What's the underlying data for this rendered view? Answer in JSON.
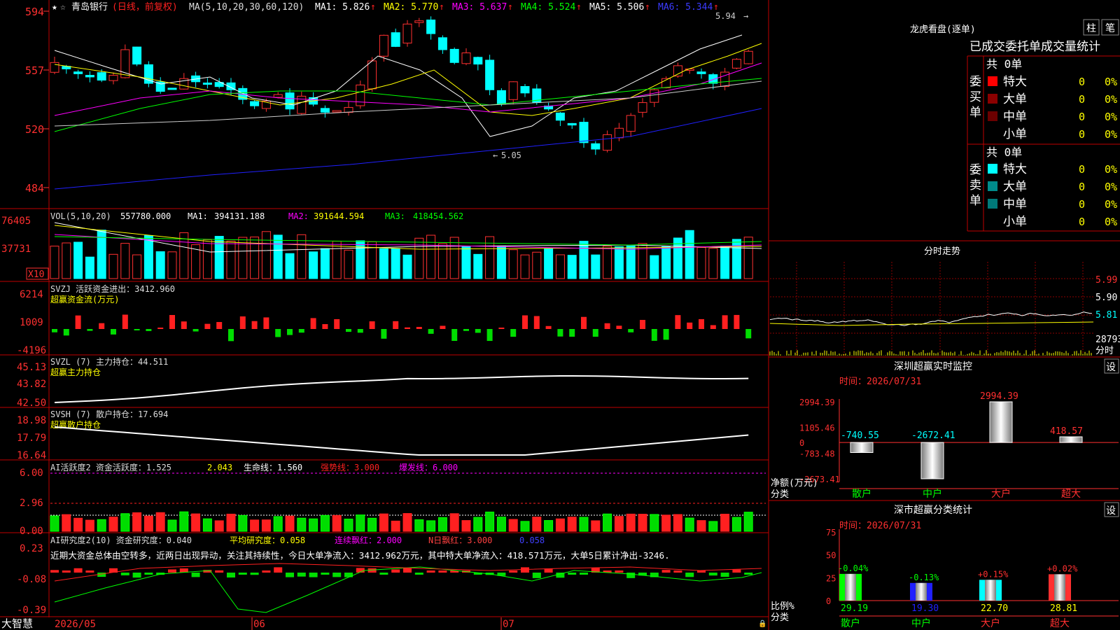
{
  "app": {
    "brand": "大智慧"
  },
  "kline": {
    "stock": "青岛银行",
    "period_tag": "(日线，前复权)",
    "ma_header": "MA(5,10,20,30,60,120)",
    "ma_values": [
      {
        "label": "MA1",
        "value": "5.826",
        "color": "#ffffff"
      },
      {
        "label": "MA2",
        "value": "5.770",
        "color": "#ffff00"
      },
      {
        "label": "MA3",
        "value": "5.637",
        "color": "#ff00ff"
      },
      {
        "label": "MA4",
        "value": "5.524",
        "color": "#00ff00"
      },
      {
        "label": "MA5",
        "value": "5.506",
        "color": "#ffffff"
      },
      {
        "label": "MA6",
        "value": "5.344",
        "color": "#3b3bff"
      }
    ],
    "yticks": [
      "594",
      "557",
      "520",
      "484"
    ],
    "high_label": "5.94",
    "low_label": "5.05",
    "dates": [
      "2026/05",
      "06",
      "07"
    ]
  },
  "vol": {
    "header": "VOL(5,10,20)",
    "value": "557780.000",
    "ma1": "394131.188",
    "ma2": "391644.594",
    "ma3": "418454.562",
    "yticks": [
      "76405",
      "37731"
    ],
    "unit": "X10"
  },
  "svzj": {
    "header": "SVZJ  活跃资金进出：3412.960",
    "sub": "超赢资金流(万元)",
    "yticks": [
      "6214",
      "1009",
      "-4196"
    ]
  },
  "svzl": {
    "header": "SVZL (7) 主力持仓：44.511",
    "sub": "超赢主力持仓",
    "yticks": [
      "45.13",
      "43.82",
      "42.50"
    ]
  },
  "svsh": {
    "header": "SVSH (7) 散户持仓：17.694",
    "sub": "超赢散户持仓",
    "yticks": [
      "18.98",
      "17.79",
      "16.64"
    ]
  },
  "ai1": {
    "header": "AI活跃度2 资金活跃度：1.525",
    "v2": "2.043",
    "life": "生命线：1.560",
    "strong": "强势线：3.000",
    "burst": "爆发线：6.000",
    "yticks": [
      "6.00",
      "2.96",
      "0.00"
    ]
  },
  "ai2": {
    "header": "AI研究度2(10) 资金研究度：0.040",
    "avg": "平均研究度：0.058",
    "streak": "连续飘红：2.000",
    "nday": "N日飘红：3.000",
    "last": "0.058",
    "comment": "近期大资金总体由空转多，近两日出现异动，关注其持续性，今日大单净流入：3412.962万元，其中特大单净流入：418.571万元，大单5日累计净出-3246.",
    "yticks": [
      "0.23",
      "-0.08",
      "-0.39"
    ]
  },
  "lhb": {
    "title": "龙虎看盘(逐单)",
    "btn1": "柱",
    "btn2": "笔",
    "subtitle": "已成交委托单成交量统计",
    "buy_label": "委买单",
    "sell_label": "委卖单",
    "buy_total": "共 0单",
    "sell_total": "共 0单",
    "buy_rows": [
      {
        "name": "特大",
        "count": "0",
        "pct": "0%",
        "color": "#ff0000"
      },
      {
        "name": "大单",
        "count": "0",
        "pct": "0%",
        "color": "#8b0000"
      },
      {
        "name": "中单",
        "count": "0",
        "pct": "0%",
        "color": "#6b0000"
      },
      {
        "name": "小单",
        "count": "0",
        "pct": "0%",
        "color": "#000000"
      }
    ],
    "sell_rows": [
      {
        "name": "特大",
        "count": "0",
        "pct": "0%",
        "color": "#00ffff"
      },
      {
        "name": "大单",
        "count": "0",
        "pct": "0%",
        "color": "#008b8b"
      },
      {
        "name": "中单",
        "count": "0",
        "pct": "0%",
        "color": "#007a7a"
      },
      {
        "name": "小单",
        "count": "0",
        "pct": "0%",
        "color": "#000000"
      }
    ]
  },
  "fenshi": {
    "title": "分时走势",
    "yticks": [
      "5.99",
      "5.90",
      "5.81"
    ],
    "vol_label": "28793",
    "unit": "分时"
  },
  "monitor": {
    "title": "深圳超赢实时监控",
    "time": "时间：2026/07/31",
    "settings": "设",
    "yticks": [
      "2994.39",
      "1105.46",
      "0",
      "-783.48",
      "-2673.41"
    ],
    "ylabel1": "净额(万元)",
    "ylabel2": "分类",
    "chart_data": {
      "type": "bar",
      "categories": [
        "散户",
        "中户",
        "大户",
        "超大"
      ],
      "values": [
        -740.55,
        -2672.41,
        2994.39,
        418.57
      ],
      "value_labels": [
        "-740.55",
        "-2672.41",
        "2994.39",
        "418.57"
      ]
    }
  },
  "classify": {
    "title": "深市超赢分类统计",
    "time": "时间：2026/07/31",
    "settings": "设",
    "yticks": [
      "75",
      "50",
      "25",
      "0"
    ],
    "ylabel1": "比例%",
    "ylabel2": "分类",
    "chart_data": {
      "type": "bar",
      "categories": [
        "散户",
        "中户",
        "大户",
        "超大"
      ],
      "values": [
        29.19,
        19.3,
        22.7,
        28.81
      ],
      "changes": [
        "-0.04%",
        "-0.13%",
        "+0.15%",
        "+0.02%"
      ],
      "value_labels": [
        "29.19",
        "19.30",
        "22.70",
        "28.81"
      ]
    }
  }
}
